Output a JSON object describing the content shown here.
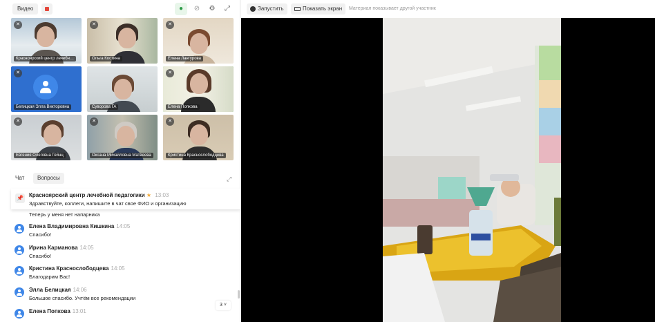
{
  "toolbar": {
    "video_label": "Видео",
    "mic_icon": "mic-on-icon",
    "cam_icon": "camera-off-icon",
    "settings_icon": "gear-icon",
    "expand_icon": "expand-icon"
  },
  "participants": [
    {
      "name": "Красноярский центр лечебн…"
    },
    {
      "name": "Ольга Костина"
    },
    {
      "name": "Елена Лангурова"
    },
    {
      "name": "Белицкая Элла Викторовна"
    },
    {
      "name": "Суворова ГА"
    },
    {
      "name": "Елена Попкова"
    },
    {
      "name": "Евгения Олеговна Гейнц"
    },
    {
      "name": "Оксана Михайловна Матвеева"
    },
    {
      "name": "Кристина Краснослободцева"
    }
  ],
  "mute_badge": "✕",
  "chat": {
    "tabs": [
      "Чат",
      "Вопросы"
    ],
    "pinned": {
      "author": "Красноярский центр лечебной педагогики",
      "star": "★",
      "time": "13:03",
      "text": "Здравствуйте, коллеги, напишите в чат свое ФИО и организацию"
    },
    "partial_text": "Теперь у меня нет напарника",
    "messages": [
      {
        "author": "Елена Владимировна Кишкина",
        "time": "14:05",
        "text": "Спасибо!"
      },
      {
        "author": "Ирина Карманова",
        "time": "14:05",
        "text": "Спасибо!"
      },
      {
        "author": "Кристина Краснослободцева",
        "time": "14:05",
        "text": "Благодарим Вас!"
      },
      {
        "author": "Элла Белицкая",
        "time": "14:06",
        "text": "Большое спасибо. Учтём все рекомендации"
      },
      {
        "author": "Елена Попкова",
        "time": "13:01",
        "text": ""
      }
    ],
    "unread_count": "3 ˅"
  },
  "share": {
    "start_label": "Запустить",
    "share_label": "Показать экран",
    "note": "Материал показывает другой участник"
  },
  "colors": {
    "accent_blue": "#3f87e8",
    "active_green": "#4cbf5a",
    "record_red": "#e4473b",
    "star_orange": "#f3a833"
  }
}
